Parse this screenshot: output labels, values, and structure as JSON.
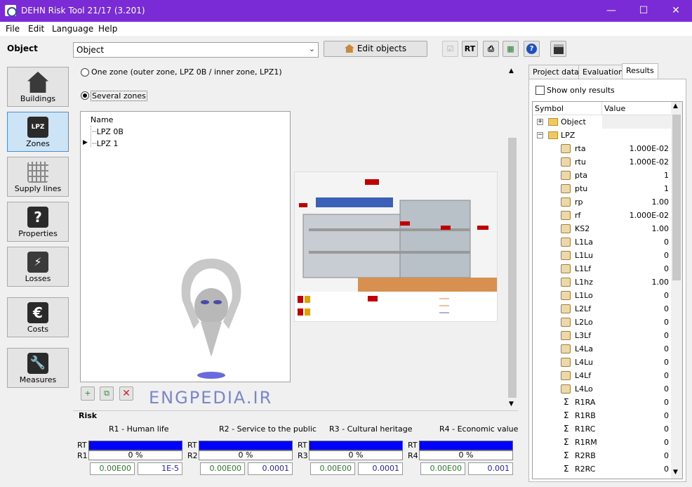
{
  "window": {
    "title": "DEHN Risk Tool 21/17 (3.201)",
    "min": "—",
    "max": "☐",
    "close": "✕"
  },
  "menu": [
    "File",
    "Edit",
    "Language",
    "Help"
  ],
  "toolbar": {
    "object_label": "Object",
    "combo_value": "Object",
    "combo_arrow": "⌄",
    "edit_objects": "Edit objects",
    "rt": "RT"
  },
  "sidebar": [
    {
      "label": "Buildings"
    },
    {
      "label": "Zones",
      "badge": "LPZ"
    },
    {
      "label": "Supply lines"
    },
    {
      "label": "Properties"
    },
    {
      "label": "Losses"
    },
    {
      "label": "Costs"
    },
    {
      "label": "Measures"
    }
  ],
  "zones": {
    "option_one": "One zone (outer zone, LPZ 0B / inner zone, LPZ1)",
    "option_several": "Several zones",
    "header": "Name",
    "items": [
      "LPZ 0B",
      "LPZ 1"
    ]
  },
  "watermark": "ENGPEDIA.IR",
  "risk": {
    "title": "Risk",
    "row_rt": "RT",
    "cols": [
      {
        "title": "R1 - Human life",
        "rlabel": "R1",
        "pct": "0 %",
        "v1": "0.00E00",
        "v2": "1E-5"
      },
      {
        "title": "R2 - Service to the public",
        "rlabel": "R2",
        "pct": "0 %",
        "v1": "0.00E00",
        "v2": "0.0001"
      },
      {
        "title": "R3 - Cultural heritage",
        "rlabel": "R3",
        "pct": "0 %",
        "v1": "0.00E00",
        "v2": "0.0001"
      },
      {
        "title": "R4 - Economic value",
        "rlabel": "R4",
        "pct": "0 %",
        "v1": "0.00E00",
        "v2": "0.001"
      }
    ]
  },
  "right": {
    "tabs": [
      "Project data",
      "Evaluation",
      "Results"
    ],
    "show_only": "Show only results",
    "col_symbol": "Symbol",
    "col_value": "Value",
    "rows": [
      {
        "k": "folder",
        "s": "Object",
        "v": ""
      },
      {
        "k": "folder",
        "s": "LPZ",
        "v": ""
      },
      {
        "k": "p",
        "s": "rta",
        "v": "1.000E-02"
      },
      {
        "k": "p",
        "s": "rtu",
        "v": "1.000E-02"
      },
      {
        "k": "p",
        "s": "pta",
        "v": "1"
      },
      {
        "k": "p",
        "s": "ptu",
        "v": "1"
      },
      {
        "k": "p",
        "s": "rp",
        "v": "1.00"
      },
      {
        "k": "p",
        "s": "rf",
        "v": "1.000E-02"
      },
      {
        "k": "p",
        "s": "KS2",
        "v": "1.00"
      },
      {
        "k": "p",
        "s": "L1La",
        "v": "0"
      },
      {
        "k": "p",
        "s": "L1Lu",
        "v": "0"
      },
      {
        "k": "p",
        "s": "L1Lf",
        "v": "0"
      },
      {
        "k": "p",
        "s": "L1hz",
        "v": "1.00"
      },
      {
        "k": "p",
        "s": "L1Lo",
        "v": "0"
      },
      {
        "k": "p",
        "s": "L2Lf",
        "v": "0"
      },
      {
        "k": "p",
        "s": "L2Lo",
        "v": "0"
      },
      {
        "k": "p",
        "s": "L3Lf",
        "v": "0"
      },
      {
        "k": "p",
        "s": "L4La",
        "v": "0"
      },
      {
        "k": "p",
        "s": "L4Lu",
        "v": "0"
      },
      {
        "k": "p",
        "s": "L4Lf",
        "v": "0"
      },
      {
        "k": "p",
        "s": "L4Lo",
        "v": "0"
      },
      {
        "k": "s",
        "s": "R1RA",
        "v": "0"
      },
      {
        "k": "s",
        "s": "R1RB",
        "v": "0"
      },
      {
        "k": "s",
        "s": "R1RC",
        "v": "0"
      },
      {
        "k": "s",
        "s": "R1RM",
        "v": "0"
      },
      {
        "k": "s",
        "s": "R2RB",
        "v": "0"
      },
      {
        "k": "s",
        "s": "R2RC",
        "v": "0"
      }
    ]
  }
}
